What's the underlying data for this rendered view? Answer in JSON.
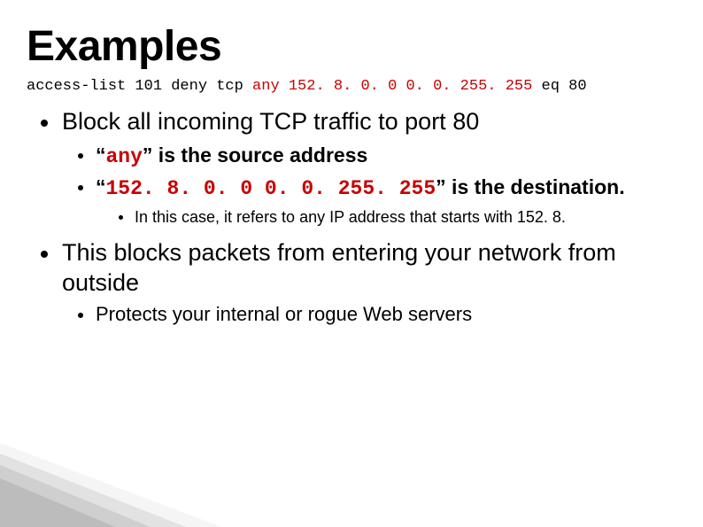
{
  "title": "Examples",
  "code": {
    "prefix": "access-list 101 deny tcp ",
    "red": "any 152. 8. 0. 0 0. 0. 255. 255",
    "suffix": " eq 80"
  },
  "bullets": {
    "b1": {
      "text": "Block all incoming TCP traffic to port 80",
      "sub": {
        "s1": {
          "q1": "“",
          "any": "any",
          "after": "” is the source address"
        },
        "s2": {
          "q1": "“",
          "dest": "152. 8. 0. 0 0. 0. 255. 255",
          "after": "” is the destination."
        },
        "s2_sub": "In this case, it refers to any IP address that starts with 152. 8."
      }
    },
    "b2": {
      "text": "This blocks packets from entering your network from outside",
      "sub": "Protects your internal or rogue Web servers"
    }
  }
}
